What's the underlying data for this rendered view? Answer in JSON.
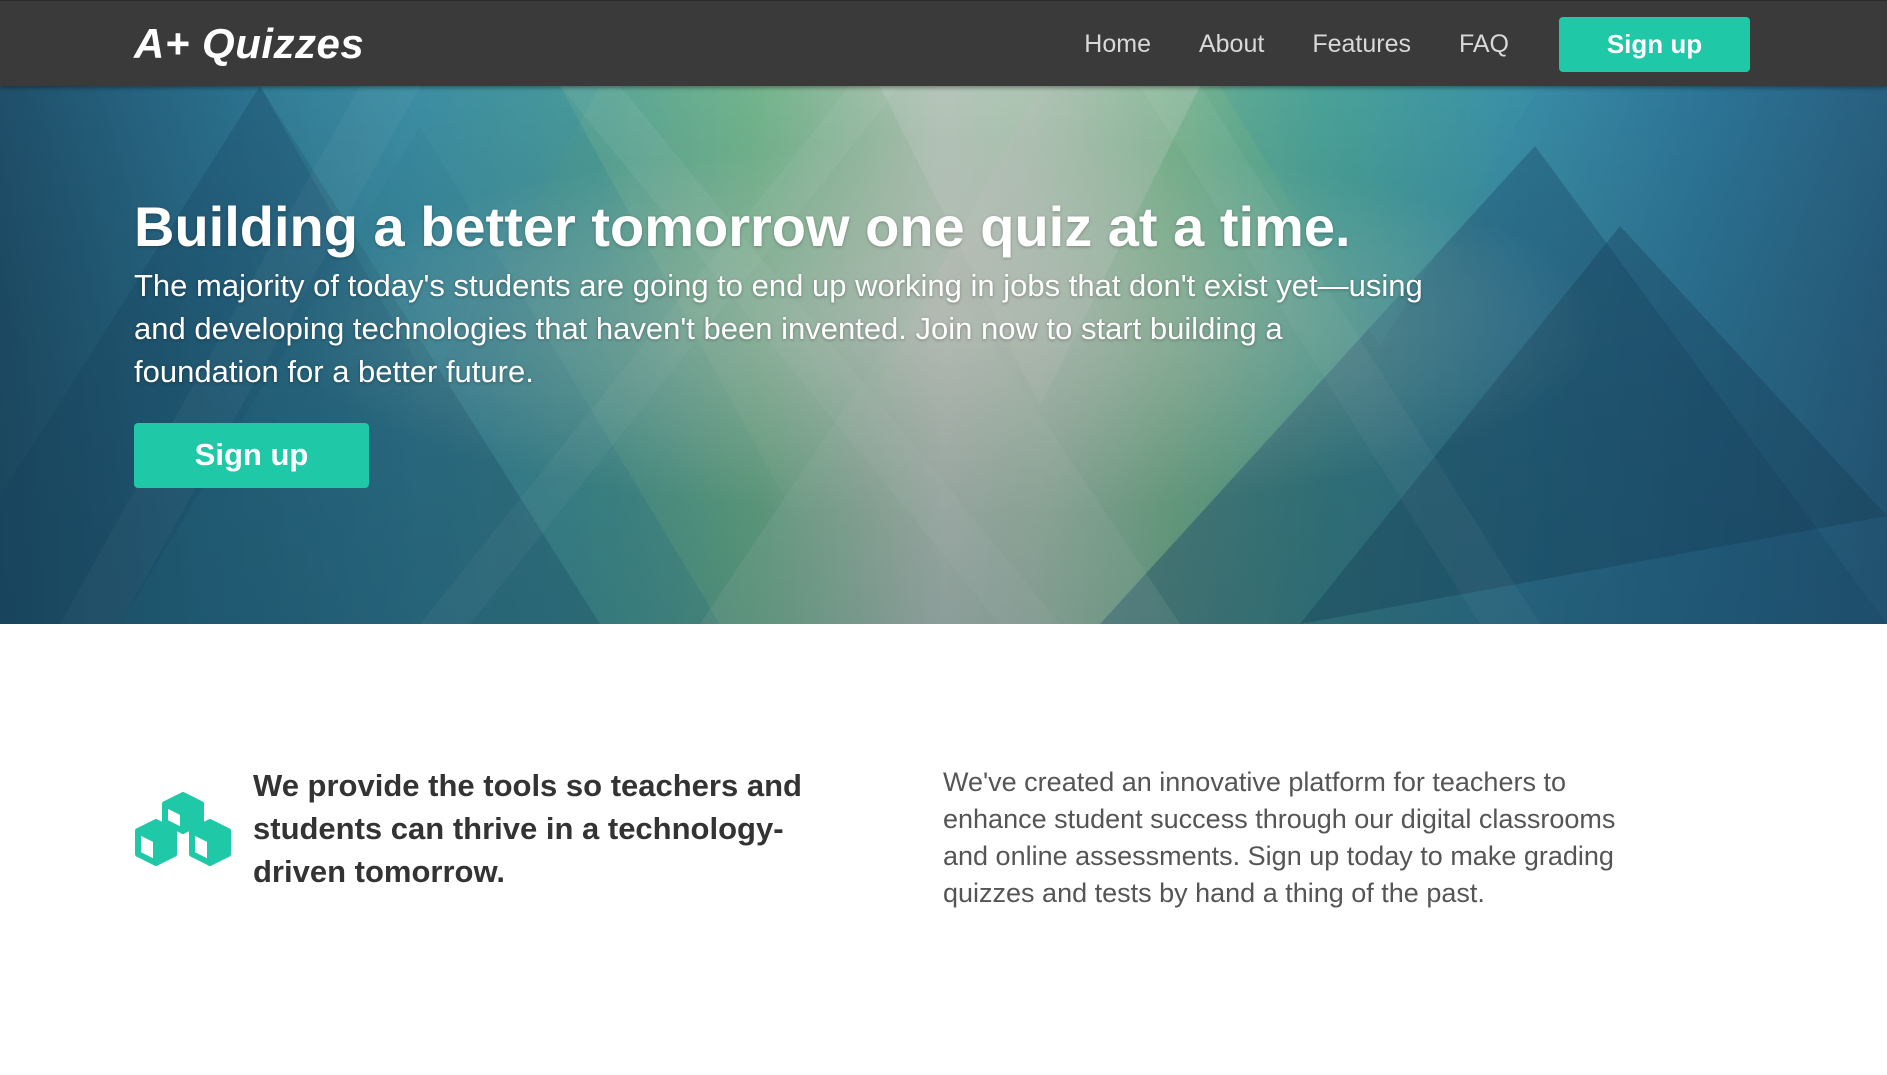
{
  "navbar": {
    "brand": "A+ Quizzes",
    "links": [
      "Home",
      "About",
      "Features",
      "FAQ"
    ],
    "signup_label": "Sign up"
  },
  "hero": {
    "title": "Building a better tomorrow one quiz at a time.",
    "text": "The majority of today's students are going to end up working in jobs that don't exist yet—using and developing technologies that haven't been invented. Join now to start building a foundation for a better future.",
    "signup_label": "Sign up"
  },
  "feature": {
    "icon": "cubes-icon",
    "heading": "We provide the tools so teachers and students can thrive in a technology-driven tomorrow.",
    "text": "We've created an innovative platform for teachers to enhance student success through our digital classrooms and online assessments. Sign up today to make grading quizzes and tests by hand a thing of the past."
  },
  "colors": {
    "accent": "#1fc8a7",
    "navbar_bg": "#3a3a3a",
    "heading_text": "#333333",
    "body_text": "#555555"
  }
}
